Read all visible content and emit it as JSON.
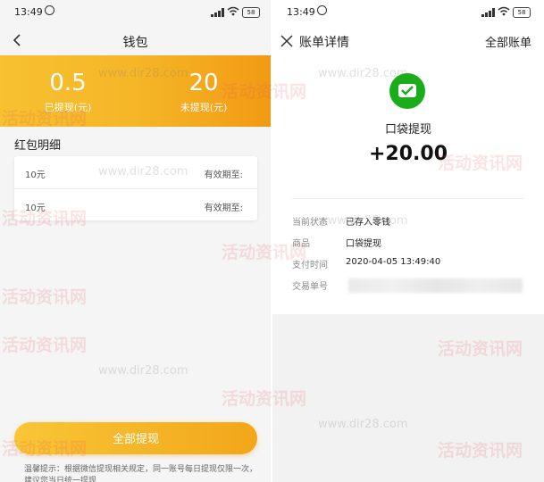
{
  "status_bar": {
    "time": "13:49",
    "battery": "58"
  },
  "left": {
    "nav_title": "钱包",
    "banner": {
      "withdrawn_value": "0.5",
      "withdrawn_label": "已提现(元)",
      "pending_value": "20",
      "pending_label": "未提现(元)"
    },
    "section_title": "红包明细",
    "rows": [
      {
        "amount": "10元",
        "valid": "有效期至:"
      },
      {
        "amount": "10元",
        "valid": "有效期至:"
      }
    ],
    "withdraw_button": "全部提现",
    "tips": "温馨提示：根据微信提现相关规定，同一账号每日提现仅限一次，建议您当日统一提现"
  },
  "right": {
    "nav_title": "账单详情",
    "nav_action": "全部账单",
    "merchant": "口袋提现",
    "amount": "+20.00",
    "fields": [
      {
        "key": "当前状态",
        "value": "已存入零钱"
      },
      {
        "key": "商品",
        "value": "口袋提现"
      },
      {
        "key": "支付时间",
        "value": "2020-04-05 13:49:40"
      },
      {
        "key": "交易单号",
        "value": ""
      }
    ]
  },
  "watermark": {
    "text": "活动资讯网",
    "url": "www.dir28.com"
  },
  "colors": {
    "accent_orange": "#f5a623",
    "wechat_green": "#1aad19"
  }
}
